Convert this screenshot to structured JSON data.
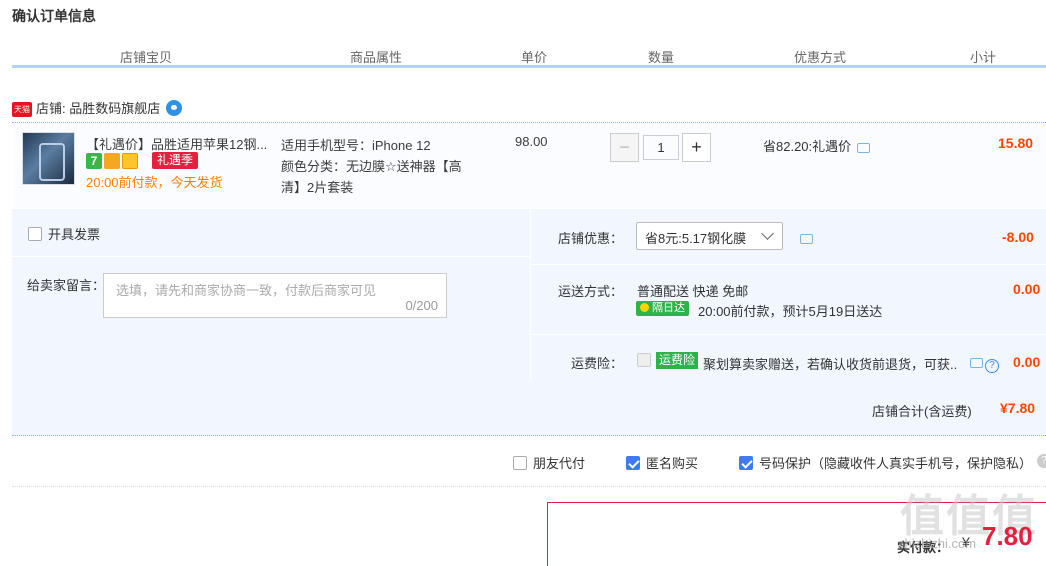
{
  "page_title": "确认订单信息",
  "columns": [
    "店铺宝贝",
    "商品属性",
    "单价",
    "数量",
    "优惠方式",
    "小计"
  ],
  "shop": {
    "badge": "天猫",
    "label": "店铺: 品胜数码旗舰店"
  },
  "item": {
    "name": "【礼遇价】品胜适用苹果12钢...",
    "tag_7": "7",
    "promo_tag": "礼遇季",
    "ship_note": "20:00前付款，今天发货",
    "attr_model": "适用手机型号：iPhone 12",
    "attr_color": "颜色分类：无边膜☆送神器【高清】2片套装",
    "price": "98.00",
    "qty_minus": "−",
    "qty_value": "1",
    "qty_plus": "+",
    "promo": "省82.20:礼遇价",
    "subtotal": "15.80"
  },
  "invoice_label": "开具发票",
  "message": {
    "label": "给卖家留言：",
    "placeholder": "选填，请先和商家协商一致，付款后商家可见",
    "counter": "0/200"
  },
  "shop_discount": {
    "label": "店铺优惠：",
    "selected": "省8元:5.17钢化膜",
    "value": "-8.00"
  },
  "shipping": {
    "label": "运送方式：",
    "method": "普通配送 快递 免邮",
    "badge": "隔日达",
    "note": "20:00前付款，预计5月19日送达",
    "value": "0.00"
  },
  "insurance": {
    "label": "运费险：",
    "tag": "运费险",
    "text": "聚划算卖家赠送，若确认收货前退货，可获...",
    "qmark": "?",
    "value": "0.00"
  },
  "shop_total": {
    "label": "店铺合计(含运费)",
    "value": "¥7.80"
  },
  "options": {
    "friend_pay": "朋友代付",
    "anonymous": "匿名购买",
    "number_protect": "号码保护（隐藏收件人真实手机号，保护隐私）"
  },
  "help_qmark": "?",
  "payment": {
    "label": "实付款：",
    "currency": "¥",
    "value": "7.80"
  },
  "watermark": {
    "logo": "值值值",
    "site": "zhizhizhi.com"
  },
  "colors": {
    "accent_red": "#e5203f",
    "subtotal_orange": "#ff4400",
    "header_line": "#b2d1ff",
    "panel_bg": "#f2f7ff",
    "check_blue": "#3d7cf0",
    "green_badge": "#2cb34a"
  }
}
